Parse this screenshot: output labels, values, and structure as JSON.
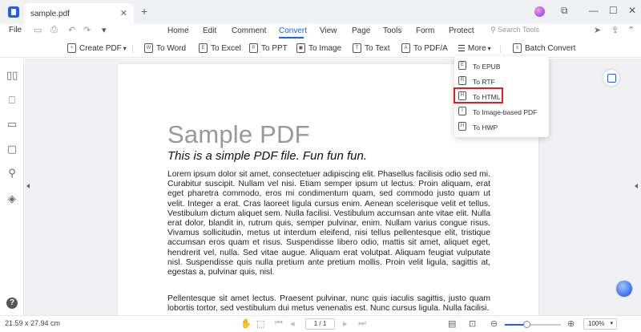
{
  "titlebar": {
    "tab_title": "sample.pdf",
    "close_glyph": "✕",
    "new_tab_glyph": "+",
    "window_controls": [
      "⧉",
      "—",
      "☐",
      "✕"
    ],
    "brand_color": "#1f5ef2"
  },
  "menubar": {
    "file_label": "File",
    "items": [
      {
        "label": "Home",
        "active": false
      },
      {
        "label": "Edit",
        "active": false
      },
      {
        "label": "Comment",
        "active": false
      },
      {
        "label": "Convert",
        "active": true
      },
      {
        "label": "View",
        "active": false
      },
      {
        "label": "Page",
        "active": false
      },
      {
        "label": "Tools",
        "active": false
      },
      {
        "label": "Form",
        "active": false
      },
      {
        "label": "Protect",
        "active": false
      }
    ],
    "search_tools": "Search Tools"
  },
  "ribbon": {
    "create_pdf": "Create PDF",
    "to_word": "To Word",
    "to_excel": "To Excel",
    "to_ppt": "To PPT",
    "to_image": "To Image",
    "to_text": "To Text",
    "to_pdfa": "To PDF/A",
    "more": "More",
    "batch_convert": "Batch Convert"
  },
  "dropdown": {
    "items": [
      {
        "label": "To EPUB",
        "icon": "E",
        "highlighted": false
      },
      {
        "label": "To RTF",
        "icon": "R",
        "highlighted": false
      },
      {
        "label": "To HTML",
        "icon": "H",
        "highlighted": true
      },
      {
        "label": "To Image-based PDF",
        "icon": "I",
        "highlighted": false
      },
      {
        "label": "To HWP",
        "icon": "H",
        "highlighted": false
      }
    ],
    "highlight_color": "#e02020"
  },
  "document": {
    "title": "Sample PDF",
    "subtitle": "This is a simple PDF file. Fun fun fun.",
    "paragraph1": "Lorem ipsum dolor sit amet, consectetuer adipiscing elit. Phasellus facilisis odio sed mi. Curabitur suscipit. Nullam vel nisi. Etiam semper ipsum ut lectus. Proin aliquam, erat eget pharetra commodo, eros mi condimentum quam, sed commodo justo quam ut velit. Integer a erat. Cras laoreet ligula cursus enim. Aenean scelerisque velit et tellus. Vestibulum dictum aliquet sem. Nulla facilisi. Vestibulum accumsan ante vitae elit. Nulla erat dolor, blandit in, rutrum quis, semper pulvinar, enim. Nullam varius congue risus. Vivamus sollicitudin, metus ut interdum eleifend, nisi tellus pellentesque elit, tristique accumsan eros quam et risus. Suspendisse libero odio, mattis sit amet, aliquet eget, hendrerit vel, nulla. Sed vitae augue. Aliquam erat volutpat. Aliquam feugiat vulputate nisl. Suspendisse quis nulla pretium ante pretium mollis. Proin velit ligula, sagittis at, egestas a, pulvinar quis, nisl.",
    "paragraph2": "Pellentesque sit amet lectus. Praesent pulvinar, nunc quis iaculis sagittis, justo quam lobortis tortor, sed vestibulum dui metus venenatis est. Nunc cursus ligula. Nulla facilisi."
  },
  "statusbar": {
    "page_size": "21.59 x 27.94 cm",
    "page_indicator": "1 / 1",
    "zoom_level": "100%",
    "zoom_fraction": 0.38
  }
}
